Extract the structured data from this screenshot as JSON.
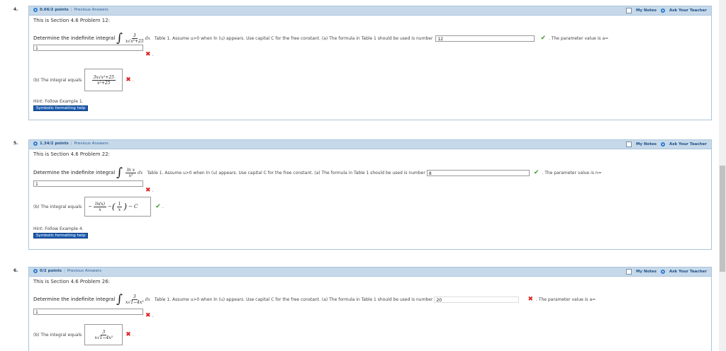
{
  "q4": {
    "number": "4.",
    "points": "0.66/2 points",
    "prev": "Previous Answers",
    "my_notes": "My Notes",
    "ask": "Ask Your Teacher",
    "title": "This is Section 4.6 Problem 12:",
    "determine": "Determine the indefinite integral",
    "frac_num": "3",
    "frac_den": "x√x²+25",
    "dx": "dx",
    "instructions": "Table 1. Assume u>0 when ln (u) appears. Use capital C for the free constant. (a) The formula in Table 1 should be used is number",
    "formula_num": "12",
    "param_text": ". The parameter value is a=",
    "param_value": "1",
    "b_label": "(b) The integral equals",
    "ans_num": "3x√x²+25",
    "ans_den": "x²+25",
    "hint": "Hint: Follow Example 1.",
    "symbolic": "Symbolic formatting help"
  },
  "q5": {
    "number": "5.",
    "points": "1.34/2 points",
    "prev": "Previous Answers",
    "my_notes": "My Notes",
    "ask": "Ask Your Teacher",
    "title": "This is Section 4.6 Problem 22:",
    "determine": "Determine the indefinite integral",
    "frac_num": "ln x",
    "frac_den": "x²",
    "dx": "dx",
    "instructions": "Table 1. Assume u>0 when ln (u) appears. Use capital C for the free constant. (a) The formula in Table 1 should be used is number",
    "formula_num": "8",
    "param_text": ". The parameter value is n=",
    "param_value": "1",
    "b_label": "(b) The integral equals",
    "ans_a_num": "ln(x)",
    "ans_a_den": "x",
    "ans_b_num": "1",
    "ans_b_den": "x",
    "ans_c": "C",
    "hint": "Hint: Follow Example 4.",
    "symbolic": "Symbolic formatting help"
  },
  "q6": {
    "number": "6.",
    "points": "0/2 points",
    "prev": "Previous Answers",
    "my_notes": "My Notes",
    "ask": "Ask Your Teacher",
    "title": "This is Section 4.6 Problem 26:",
    "determine": "Determine the indefinite integral",
    "frac_num": "3",
    "frac_den": "x√1−4x²",
    "dx": "dx",
    "instructions": "Table 1. Assume u>0 when ln (u) appears. Use capital C for the free constant. (a) The formula in Table 1 should be used is number",
    "formula_num": "20",
    "param_text": ". The parameter value is a=",
    "param_value": "1",
    "b_label": "(b) The integral equals",
    "ans_num": "3",
    "ans_den": "x√1−4x²"
  },
  "icons": {
    "correct": "checkmark-icon",
    "incorrect": "cross-icon"
  },
  "colors": {
    "header_bg": "#c6d9ea",
    "correct": "#3b9a2a",
    "incorrect": "#d22222"
  }
}
